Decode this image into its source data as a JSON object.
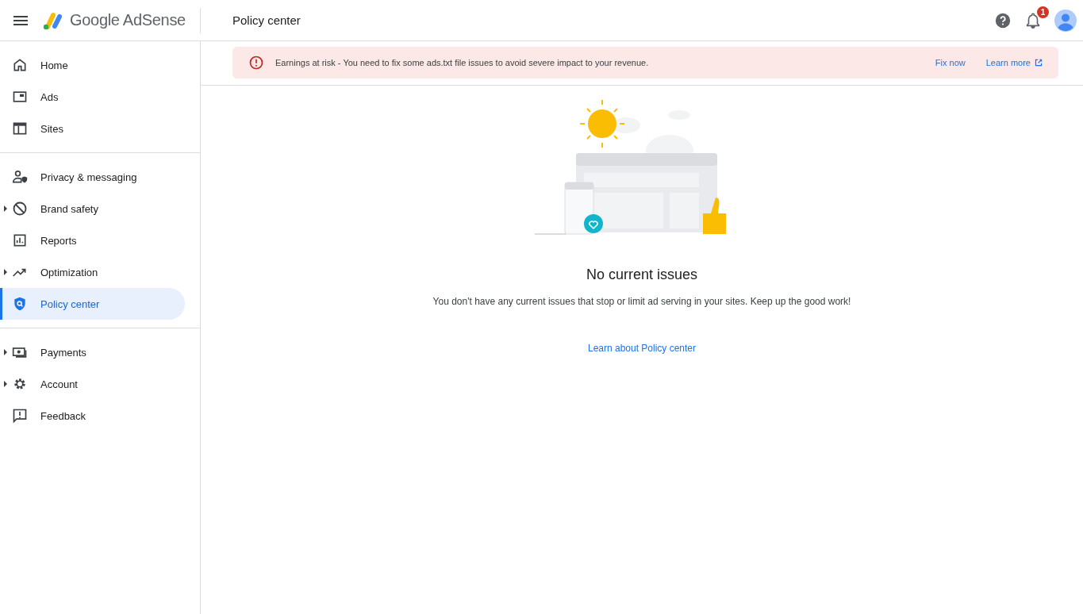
{
  "header": {
    "product": "Google AdSense",
    "page_title": "Policy center",
    "notification_count": "1"
  },
  "sidebar": {
    "sections": [
      [
        {
          "label": "Home",
          "expandable": false,
          "selected": false
        },
        {
          "label": "Ads",
          "expandable": false,
          "selected": false
        },
        {
          "label": "Sites",
          "expandable": false,
          "selected": false
        }
      ],
      [
        {
          "label": "Privacy & messaging",
          "expandable": false,
          "selected": false
        },
        {
          "label": "Brand safety",
          "expandable": true,
          "selected": false
        },
        {
          "label": "Reports",
          "expandable": false,
          "selected": false
        },
        {
          "label": "Optimization",
          "expandable": true,
          "selected": false
        },
        {
          "label": "Policy center",
          "expandable": false,
          "selected": true
        }
      ],
      [
        {
          "label": "Payments",
          "expandable": true,
          "selected": false
        },
        {
          "label": "Account",
          "expandable": true,
          "selected": false
        },
        {
          "label": "Feedback",
          "expandable": false,
          "selected": false
        }
      ]
    ]
  },
  "alert": {
    "message": "Earnings at risk - You need to fix some ads.txt file issues to avoid severe impact to your revenue.",
    "actions": [
      "Fix now",
      "Learn more"
    ]
  },
  "empty_state": {
    "title": "No current issues",
    "description": "You don't have any current issues that stop or limit ad serving in your sites. Keep up the good work!",
    "link": "Learn about Policy center"
  }
}
